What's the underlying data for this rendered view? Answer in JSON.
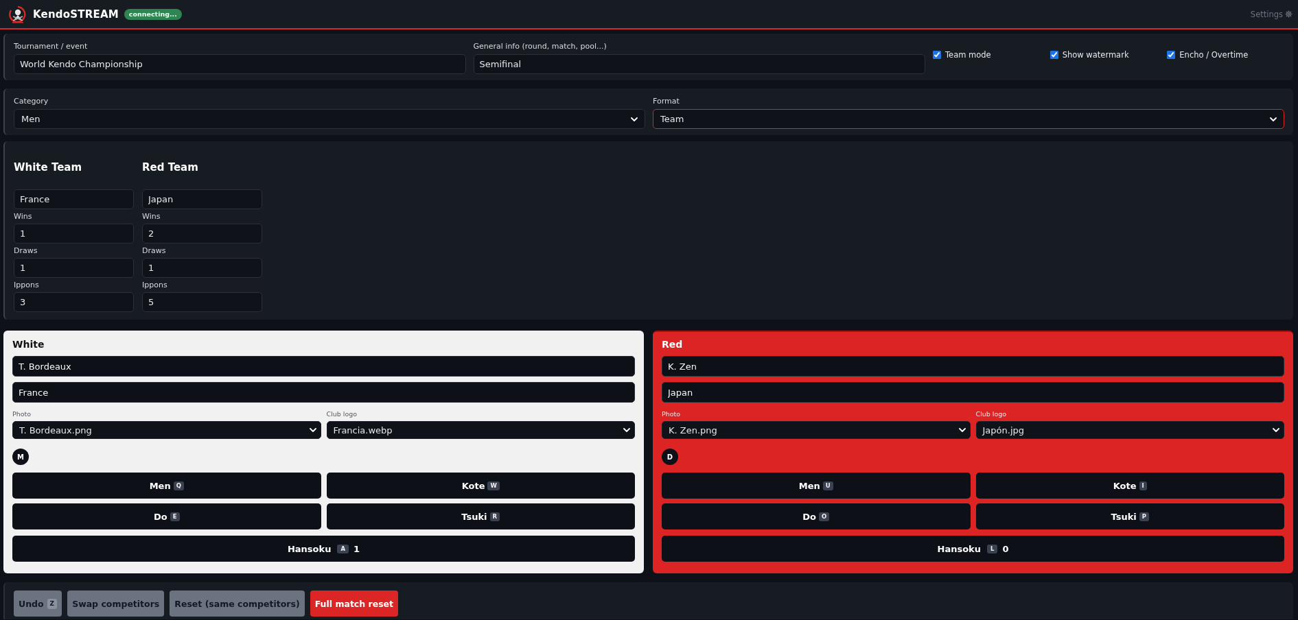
{
  "header": {
    "app_name": "KendoSTREAM",
    "status_badge": "connecting...",
    "settings_label": "Settings"
  },
  "event": {
    "fields": [
      {
        "label": "Tournament / event",
        "value": "World Kendo Championship"
      },
      {
        "label": "General info (round, match, pool...)",
        "value": "Semifinal"
      }
    ],
    "options": [
      {
        "label": "Team mode",
        "checked": true
      },
      {
        "label": "Show watermark",
        "checked": true
      },
      {
        "label": "Encho / Overtime",
        "checked": true
      }
    ]
  },
  "selection": {
    "fields": [
      {
        "label": "Category",
        "value": "Men",
        "focused": false
      },
      {
        "label": "Format",
        "value": "Team",
        "focused": true
      }
    ]
  },
  "teams": [
    {
      "heading": "White Team",
      "name": "France",
      "stats": [
        {
          "label": "Wins",
          "value": "1"
        },
        {
          "label": "Draws",
          "value": "1"
        },
        {
          "label": "Ippons",
          "value": "3"
        }
      ]
    },
    {
      "heading": "Red Team",
      "name": "Japan",
      "stats": [
        {
          "label": "Wins",
          "value": "2"
        },
        {
          "label": "Draws",
          "value": "1"
        },
        {
          "label": "Ippons",
          "value": "5"
        }
      ]
    }
  ],
  "competitors": [
    {
      "kind": "white",
      "heading": "White",
      "name": "T. Bordeaux",
      "club": "France",
      "photo_label": "Photo",
      "photo": "T. Bordeaux.png",
      "logo_label": "Club logo",
      "logo": "Francia.webp",
      "points": [
        "M"
      ],
      "strikes": [
        {
          "label": "Men",
          "key": "Q"
        },
        {
          "label": "Kote",
          "key": "W"
        },
        {
          "label": "Do",
          "key": "E"
        },
        {
          "label": "Tsuki",
          "key": "R"
        }
      ],
      "hansoku": {
        "label": "Hansoku",
        "key": "A",
        "count": "1"
      }
    },
    {
      "kind": "red",
      "heading": "Red",
      "name": "K. Zen",
      "club": "Japan",
      "photo_label": "Photo",
      "photo": "K. Zen.png",
      "logo_label": "Club logo",
      "logo": "Japón.jpg",
      "points": [
        "D"
      ],
      "strikes": [
        {
          "label": "Men",
          "key": "U"
        },
        {
          "label": "Kote",
          "key": "I"
        },
        {
          "label": "Do",
          "key": "O"
        },
        {
          "label": "Tsuki",
          "key": "P"
        }
      ],
      "hansoku": {
        "label": "Hansoku",
        "key": "L",
        "count": "0"
      }
    }
  ],
  "actions": [
    {
      "label": "Undo",
      "key": "Z",
      "kind": "secondary"
    },
    {
      "label": "Swap competitors",
      "kind": "secondary"
    },
    {
      "label": "Reset (same competitors)",
      "kind": "secondary"
    },
    {
      "label": "Full match reset",
      "kind": "danger"
    }
  ]
}
